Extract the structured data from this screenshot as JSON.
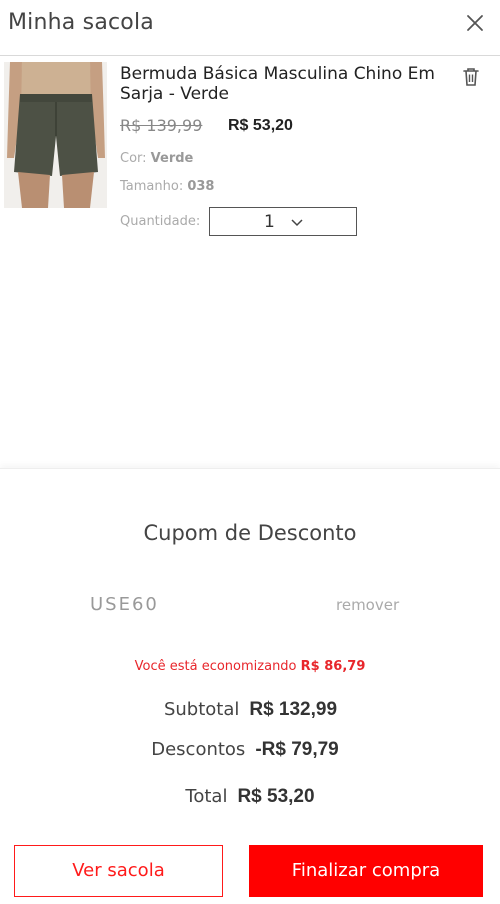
{
  "header": {
    "title": "Minha sacola",
    "close_icon": "close-icon"
  },
  "cart_item": {
    "name": "Bermuda Básica Masculina Chino Em Sarja - Verde",
    "image_alt_icon": "shorts-product-photo",
    "old_price": "R$ 139,99",
    "price": "R$ 53,20",
    "color_label": "Cor:",
    "color_value": "Verde",
    "size_label": "Tamanho:",
    "size_value": "038",
    "quantity_label": "Quantidade:",
    "quantity_value": "1",
    "delete_icon": "trash-icon"
  },
  "summary": {
    "coupon_title": "Cupom de Desconto",
    "coupon_code": "USE60",
    "coupon_remove": "remover",
    "savings_text": "Você está economizando",
    "savings_value": "R$ 86,79",
    "subtotal_label": "Subtotal",
    "subtotal_value": "R$ 132,99",
    "discount_label": "Descontos",
    "discount_value": "-R$ 79,79",
    "total_label": "Total",
    "total_value": "R$ 53,20"
  },
  "actions": {
    "view_bag": "Ver sacola",
    "checkout": "Finalizar compra"
  },
  "colors": {
    "accent": "#ff0000",
    "savings_text": "#e8262b",
    "product_shorts": "#4d5145"
  }
}
